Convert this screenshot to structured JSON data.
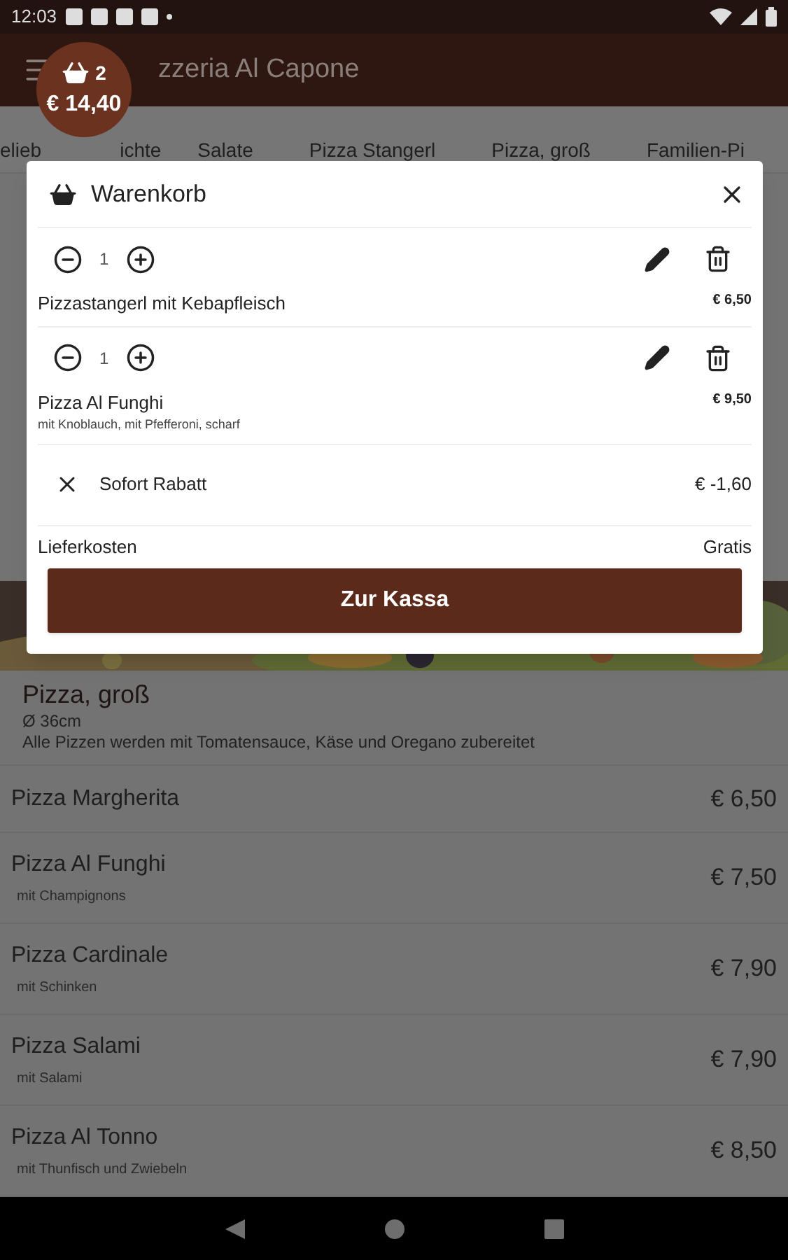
{
  "status_bar": {
    "time": "12:03"
  },
  "app_bar": {
    "title": "zzeria Al Capone"
  },
  "cart_badge": {
    "count": "2",
    "total": "€ 14,40"
  },
  "tabs": [
    {
      "label_parts": [
        "elieb",
        "ichte"
      ]
    },
    {
      "label": "Salate"
    },
    {
      "label": "Pizza Stangerl"
    },
    {
      "label": "Pizza, groß"
    },
    {
      "label": "Familien-Pi"
    }
  ],
  "section": {
    "title": "Pizza, groß",
    "size": "Ø 36cm",
    "note": "Alle Pizzen werden mit Tomatensauce, Käse und Oregano zubereitet"
  },
  "menu_items": [
    {
      "name": "Pizza Margherita",
      "price": "€ 6,50"
    },
    {
      "name": "Pizza Al Funghi",
      "description": "mit Champignons",
      "price": "€ 7,50"
    },
    {
      "name": "Pizza Cardinale",
      "description": "mit Schinken",
      "price": "€ 7,90"
    },
    {
      "name": "Pizza Salami",
      "description": "mit Salami",
      "price": "€ 7,90"
    },
    {
      "name": "Pizza Al Tonno",
      "description": "mit Thunfisch und Zwiebeln",
      "price": "€ 8,50"
    }
  ],
  "cart": {
    "title": "Warenkorb",
    "items": [
      {
        "quantity": "1",
        "name": "Pizzastangerl mit Kebapfleisch",
        "price": "€ 6,50"
      },
      {
        "quantity": "1",
        "name": "Pizza Al Funghi",
        "extras": "mit Knoblauch, mit Pfefferoni, scharf",
        "price": "€ 9,50"
      }
    ],
    "discount": {
      "label": "Sofort Rabatt",
      "amount": "€ -1,60"
    },
    "delivery": {
      "label": "Lieferkosten",
      "value": "Gratis"
    },
    "checkout_button": "Zur Kassa"
  }
}
